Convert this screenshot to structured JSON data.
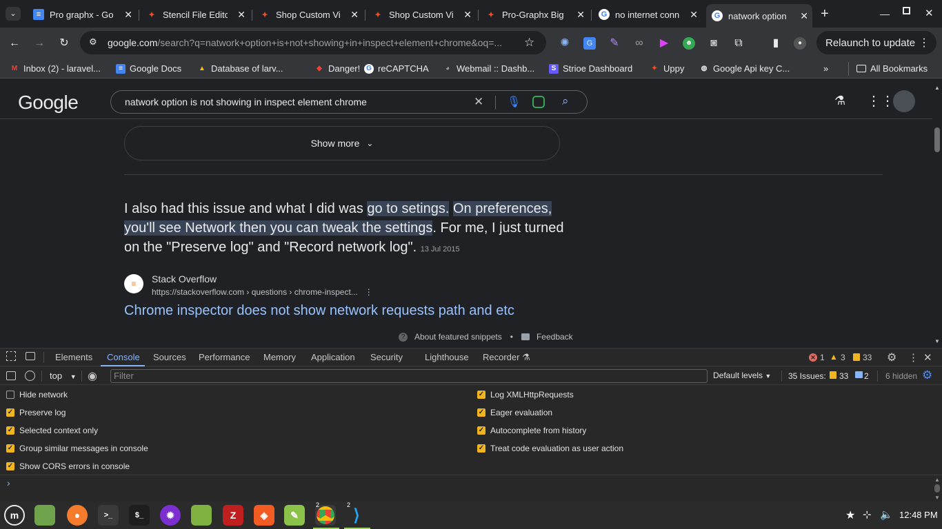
{
  "tabs": [
    {
      "title": "Pro graphx - Go",
      "icon": "docs-icon",
      "color": "#4285f4"
    },
    {
      "title": "Stencil File Edito",
      "icon": "figma-like-icon",
      "color": "#f25022"
    },
    {
      "title": "Shop Custom Vi",
      "icon": "shop-icon",
      "color": "#f25022"
    },
    {
      "title": "Shop Custom Vi",
      "icon": "shop-icon",
      "color": "#f25022"
    },
    {
      "title": "Pro-Graphx Big",
      "icon": "shop-icon",
      "color": "#f25022"
    },
    {
      "title": "no internet conn",
      "icon": "google-icon",
      "color": "#ffffff"
    },
    {
      "title": "natwork option",
      "icon": "google-icon",
      "color": "#ffffff"
    }
  ],
  "toolbar": {
    "url_host": "google.com",
    "url_path": "/search?q=natwork+option+is+not+showing+in+inspect+element+chrome&oq=...",
    "relaunch_label": "Relaunch to update"
  },
  "bookmarks": [
    {
      "label": "Inbox (2) - laravel...",
      "icon": "gmail-icon",
      "color": "#ea4335"
    },
    {
      "label": "Google Docs",
      "icon": "docs-icon",
      "color": "#4285f4"
    },
    {
      "label": "Database of larv...",
      "icon": "database-icon",
      "color": "#fbbc04"
    },
    {
      "label": "Danger!",
      "icon": "warning-icon",
      "color": "#ea4335"
    },
    {
      "label": "reCAPTCHA",
      "icon": "google-icon",
      "color": "#4285f4"
    },
    {
      "label": "Webmail :: Dashb...",
      "icon": "webmail-icon",
      "color": "#9aa0a6"
    },
    {
      "label": "Strioe Dashboard",
      "icon": "stripe-icon",
      "color": "#635bff"
    },
    {
      "label": "Uppy",
      "icon": "uppy-icon",
      "color": "#f25022"
    },
    {
      "label": "Google Api key C...",
      "icon": "globe-icon",
      "color": "#e8eaed"
    }
  ],
  "bookmarks_more": "»",
  "all_bookmarks": "All Bookmarks",
  "google": {
    "logo": "Google",
    "query": "natwork option is not showing in inspect element chrome",
    "show_more": "Show more",
    "snippet_pre": "I also had this issue and what I did was ",
    "snippet_hl1": "go to setings.",
    "snippet_hl2": "On preferences, you'll see Network then you can tweak the settings",
    "snippet_post": ". For me, I just turned on the \"Preserve log\" and \"Record network log\".",
    "snippet_date": "13 Jul 2015",
    "source_name": "Stack Overflow",
    "source_url": "https://stackoverflow.com › questions › chrome-inspect...",
    "result_title": "Chrome inspector does not show network requests path and etc",
    "about_snippets": "About featured snippets",
    "bullet": "•",
    "feedback": "Feedback"
  },
  "devtools": {
    "tabs": [
      "Elements",
      "Console",
      "Sources",
      "Performance",
      "Memory",
      "Application",
      "Security",
      "Lighthouse",
      "Recorder"
    ],
    "active_tab": "Console",
    "errors": "1",
    "warnings": "3",
    "issues_badge": "33",
    "context": "top",
    "filter_placeholder": "Filter",
    "default_levels": "Default levels",
    "issues_label": "35 Issues:",
    "issues_a": "33",
    "issues_b": "2",
    "hidden": "6 hidden",
    "options_left": [
      {
        "label": "Hide network",
        "checked": false
      },
      {
        "label": "Preserve log",
        "checked": true
      },
      {
        "label": "Selected context only",
        "checked": true
      },
      {
        "label": "Group similar messages in console",
        "checked": true
      },
      {
        "label": "Show CORS errors in console",
        "checked": true
      }
    ],
    "options_right": [
      {
        "label": "Log XMLHttpRequests",
        "checked": true
      },
      {
        "label": "Eager evaluation",
        "checked": true
      },
      {
        "label": "Autocomplete from history",
        "checked": true
      },
      {
        "label": "Treat code evaluation as user action",
        "checked": true
      }
    ],
    "prompt": "›"
  },
  "taskbar": {
    "chrome_count": "2",
    "vscode_count": "2",
    "clock": "12:48 PM"
  }
}
